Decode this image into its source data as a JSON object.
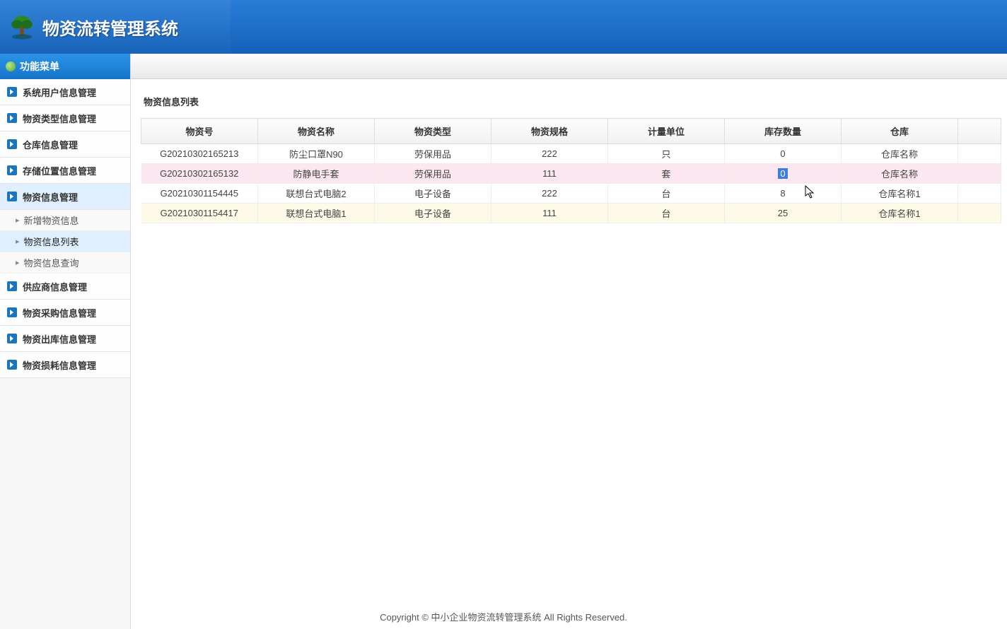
{
  "header": {
    "app_title": "物资流转管理系统"
  },
  "sidebar": {
    "title": "功能菜单",
    "items": [
      {
        "label": "系统用户信息管理",
        "expanded": false
      },
      {
        "label": "物资类型信息管理",
        "expanded": false
      },
      {
        "label": "仓库信息管理",
        "expanded": false
      },
      {
        "label": "存储位置信息管理",
        "expanded": false
      },
      {
        "label": "物资信息管理",
        "expanded": true,
        "children": [
          {
            "label": "新增物资信息",
            "selected": false
          },
          {
            "label": "物资信息列表",
            "selected": true
          },
          {
            "label": "物资信息查询",
            "selected": false
          }
        ]
      },
      {
        "label": "供应商信息管理",
        "expanded": false
      },
      {
        "label": "物资采购信息管理",
        "expanded": false
      },
      {
        "label": "物资出库信息管理",
        "expanded": false
      },
      {
        "label": "物资损耗信息管理",
        "expanded": false
      }
    ]
  },
  "main": {
    "panel_title": "物资信息列表",
    "columns": [
      "物资号",
      "物资名称",
      "物资类型",
      "物资规格",
      "计量单位",
      "库存数量",
      "仓库"
    ],
    "rows": [
      {
        "id": "G20210302165213",
        "name": "防尘口罩N90",
        "type": "劳保用品",
        "spec": "222",
        "unit": "只",
        "stock": "0",
        "wh": "仓库名称",
        "state": ""
      },
      {
        "id": "G20210302165132",
        "name": "防静电手套",
        "type": "劳保用品",
        "spec": "111",
        "unit": "套",
        "stock": "0",
        "wh": "仓库名称",
        "state": "hover"
      },
      {
        "id": "G20210301154445",
        "name": "联想台式电脑2",
        "type": "电子设备",
        "spec": "222",
        "unit": "台",
        "stock": "8",
        "wh": "仓库名称1",
        "state": ""
      },
      {
        "id": "G20210301154417",
        "name": "联想台式电脑1",
        "type": "电子设备",
        "spec": "111",
        "unit": "台",
        "stock": "25",
        "wh": "仓库名称1",
        "state": "alt"
      }
    ]
  },
  "footer": {
    "text": "Copyright © 中小企业物资流转管理系统 All Rights Reserved."
  }
}
